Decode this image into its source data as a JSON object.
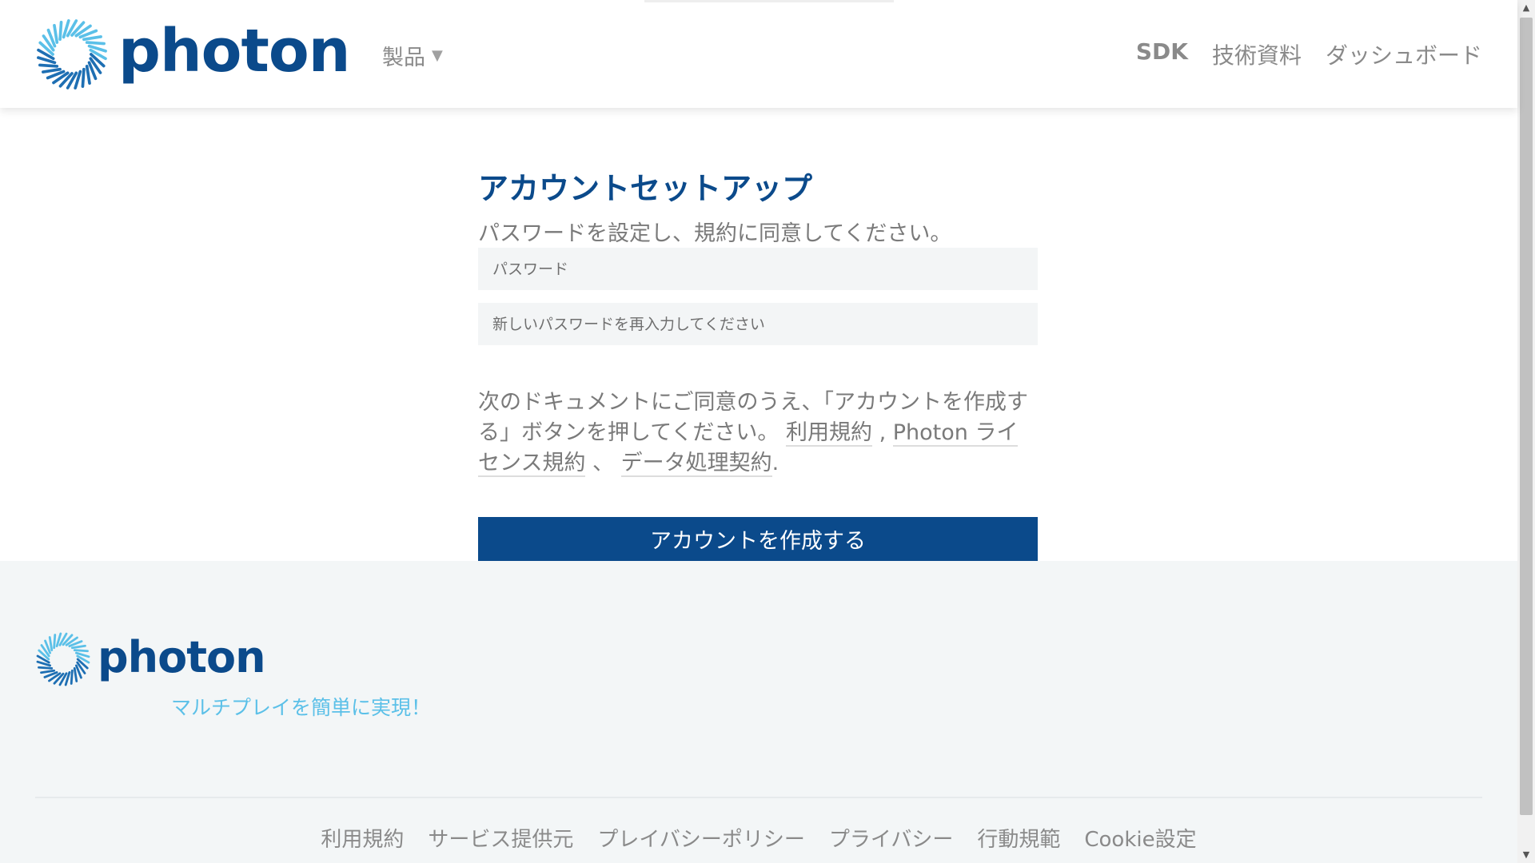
{
  "header": {
    "logo_text": "photon",
    "products_label": "製品",
    "nav": {
      "sdk": "SDK",
      "docs": "技術資料",
      "dashboard": "ダッシュボード"
    }
  },
  "main": {
    "title": "アカウントセットアップ",
    "subtitle": "パスワードを設定し、規約に同意してください。",
    "password_placeholder": "パスワード",
    "confirm_placeholder": "新しいパスワードを再入力してください",
    "terms_intro": "次のドキュメントにご同意のうえ、「アカウントを作成する」ボタンを押してください。",
    "terms_link1": "利用規約",
    "terms_sep1": " , ",
    "terms_link2": "Photon ライセンス規約",
    "terms_sep2": " 、 ",
    "terms_link3": "データ処理契約",
    "terms_end": ".",
    "create_button": "アカウントを作成する"
  },
  "footer": {
    "logo_text": "photon",
    "tagline": "マルチプレイを簡単に実現！",
    "links": [
      "利用規約",
      "サービス提供元",
      "プレイバシーポリシー",
      "プライバシー",
      "行動規範",
      "Cookie設定"
    ]
  },
  "colors": {
    "brand": "#0b4a8b",
    "accent": "#5bc0e8",
    "footer_bg": "#f3f6f7"
  }
}
